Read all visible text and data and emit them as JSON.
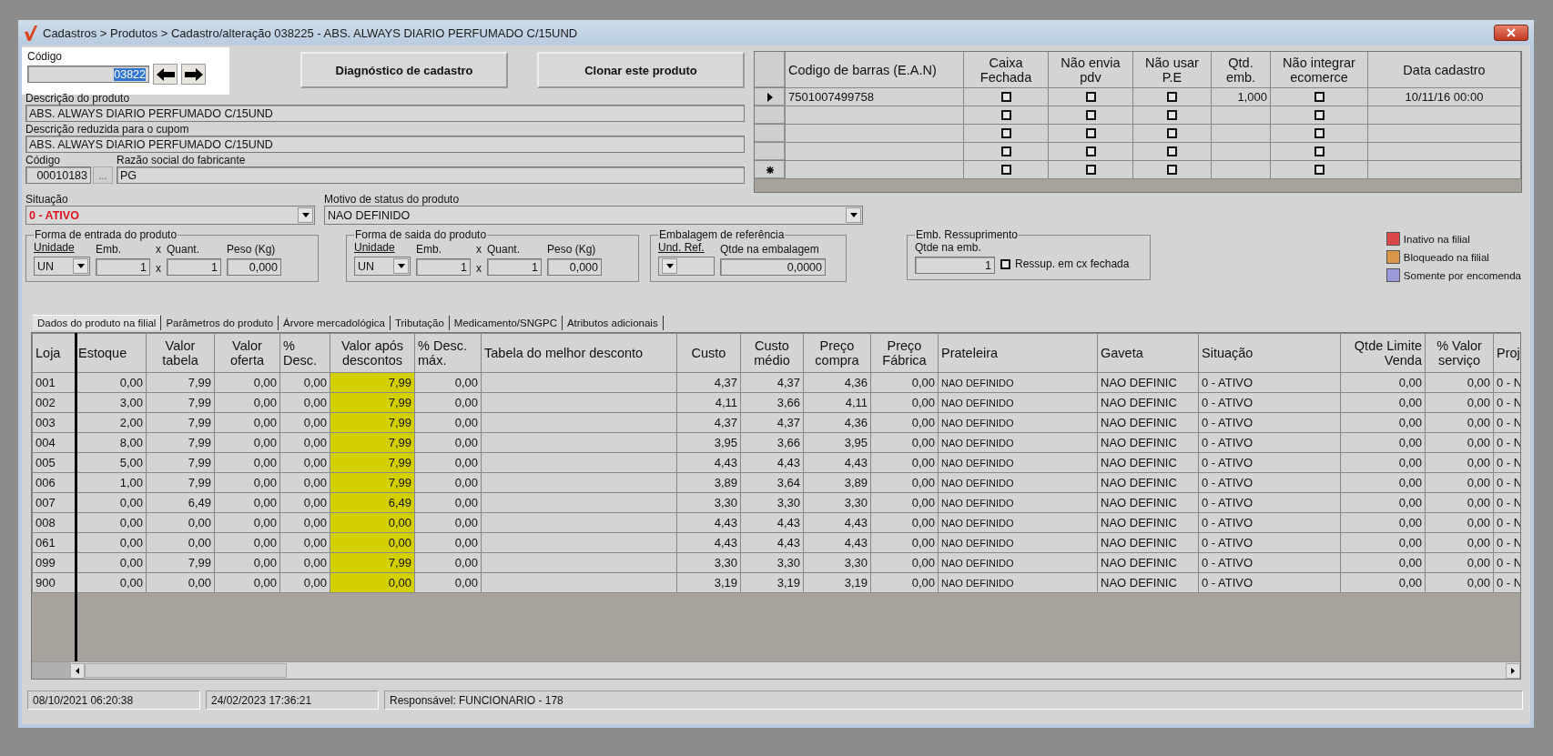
{
  "window": {
    "title": "Cadastros > Produtos > Cadastro/alteração  038225 - ABS. ALWAYS DIARIO PERFUMADO C/15UND"
  },
  "codigo": {
    "label": "Código",
    "value": "03822",
    "selected": true
  },
  "actions": [
    "Diagnóstico de cadastro",
    "Clonar este produto"
  ],
  "descricao": {
    "label": "Descrição  do produto",
    "value": "ABS. ALWAYS DIARIO PERFUMADO C/15UND"
  },
  "descricao_reduzida": {
    "label": "Descrição reduzida para o cupom",
    "value": "ABS. ALWAYS DIARIO PERFUMADO C/15UND"
  },
  "fabricante": {
    "code_label": "Código",
    "code": "00010183",
    "browse": "...",
    "name_label": "Razão social do fabricante",
    "name": "PG"
  },
  "situacao": {
    "label": "Situação",
    "value": "0 - ATIVO"
  },
  "motivo": {
    "label": "Motivo de status do produto",
    "value": "NAO DEFINIDO"
  },
  "forma_entrada": {
    "title": "Forma de entrada do produto",
    "unidade_label": "Unidade",
    "unidade": "UN",
    "emb_label": "Emb.",
    "emb": "1",
    "quant_label": "Quant.",
    "quant": "1",
    "peso_label": "Peso (Kg)",
    "peso": "0,000",
    "multiplier": [
      "x",
      "x"
    ]
  },
  "forma_saida": {
    "title": "Forma de saida do produto",
    "unidade_label": "Unidade",
    "unidade": "UN",
    "emb_label": "Emb.",
    "emb": "1",
    "quant_label": "Quant.",
    "quant": "1",
    "peso_label": "Peso (Kg)",
    "peso": "0,000",
    "multiplier": [
      "x",
      "x"
    ]
  },
  "embalagem_referencia": {
    "title": "Embalagem de referência",
    "und_label": "Und. Ref.",
    "qtde_label": "Qtde na embalagem",
    "qtde": "0,0000"
  },
  "ressuprimento": {
    "title": "Emb. Ressuprimento",
    "qtde_label": "Qtde na emb.",
    "qtde": "1",
    "check_label": "Ressup. em cx fechada",
    "checked": false
  },
  "legend": [
    {
      "label": "Inativo na filial",
      "color": "#d9474b"
    },
    {
      "label": "Bloqueado na filial",
      "color": "#d99548"
    },
    {
      "label": "Somente por encomenda",
      "color": "#9a9ad8"
    }
  ],
  "barcodes": {
    "columns": [
      "Codigo de barras (E.A.N)",
      "Caixa Fechada",
      "Não envia pdv",
      "Não usar P.E",
      "Qtd. emb.",
      "Não integrar ecomerce",
      "Data cadastro"
    ],
    "rows": [
      {
        "kind": "current",
        "ean": "7501007499758",
        "caixa_fechada": false,
        "nao_envia_pdv": false,
        "nao_usar_pe": false,
        "qtd_emb": "1,000",
        "nao_integrar": false,
        "data": "10/11/16 00:00"
      },
      {
        "kind": "none",
        "caixa_fechada": false,
        "nao_envia_pdv": false,
        "nao_usar_pe": false,
        "nao_integrar": false
      },
      {
        "kind": "none",
        "caixa_fechada": false,
        "nao_envia_pdv": false,
        "nao_usar_pe": false,
        "nao_integrar": false
      },
      {
        "kind": "none",
        "caixa_fechada": false,
        "nao_envia_pdv": false,
        "nao_usar_pe": false,
        "nao_integrar": false
      },
      {
        "kind": "new",
        "caixa_fechada": false,
        "nao_envia_pdv": false,
        "nao_usar_pe": false,
        "nao_integrar": false
      }
    ]
  },
  "tabs": [
    {
      "label": "Dados do produto na filial",
      "selected": true
    },
    {
      "label": "Parâmetros do produto",
      "selected": false
    },
    {
      "label": "Árvore mercadológica",
      "selected": false
    },
    {
      "label": "Tributação",
      "selected": false
    },
    {
      "label": "Medicamento/SNGPC",
      "selected": false
    },
    {
      "label": "Atributos adicionais",
      "selected": false
    }
  ],
  "table": {
    "columns": [
      {
        "label": "Loja",
        "highlighted": false
      },
      {
        "label": "Estoque",
        "highlighted": false
      },
      {
        "label": "Valor tabela",
        "highlighted": false
      },
      {
        "label": "Valor oferta",
        "highlighted": false
      },
      {
        "label": "% Desc.",
        "highlighted": false
      },
      {
        "label": "Valor após descontos",
        "highlighted": true
      },
      {
        "label": "% Desc. máx.",
        "highlighted": false
      },
      {
        "label": "Tabela do melhor desconto",
        "highlighted": false
      },
      {
        "label": "Custo",
        "highlighted": false
      },
      {
        "label": "Custo médio",
        "highlighted": false
      },
      {
        "label": "Preço compra",
        "highlighted": false
      },
      {
        "label": "Preço Fábrica",
        "highlighted": false
      },
      {
        "label": "Prateleira",
        "highlighted": false
      },
      {
        "label": "Gaveta",
        "highlighted": false
      },
      {
        "label": "Situação",
        "highlighted": false
      },
      {
        "label": "Qtde Limite Venda",
        "highlighted": false
      },
      {
        "label": "% Valor serviço",
        "highlighted": false
      },
      {
        "label": "Proj",
        "highlighted": false
      }
    ],
    "rows": [
      [
        "001",
        "0,00",
        "7,99",
        "0,00",
        "0,00",
        "7,99",
        "0,00",
        "",
        "4,37",
        "4,37",
        "4,36",
        "0,00",
        "NAO DEFINIDO",
        "NAO DEFINIC",
        "0 - ATIVO",
        "0,00",
        "0,00",
        "0 - N"
      ],
      [
        "002",
        "3,00",
        "7,99",
        "0,00",
        "0,00",
        "7,99",
        "0,00",
        "",
        "4,11",
        "3,66",
        "4,11",
        "0,00",
        "NAO DEFINIDO",
        "NAO DEFINIC",
        "0 - ATIVO",
        "0,00",
        "0,00",
        "0 - N"
      ],
      [
        "003",
        "2,00",
        "7,99",
        "0,00",
        "0,00",
        "7,99",
        "0,00",
        "",
        "4,37",
        "4,37",
        "4,36",
        "0,00",
        "NAO DEFINIDO",
        "NAO DEFINIC",
        "0 - ATIVO",
        "0,00",
        "0,00",
        "0 - N"
      ],
      [
        "004",
        "8,00",
        "7,99",
        "0,00",
        "0,00",
        "7,99",
        "0,00",
        "",
        "3,95",
        "3,66",
        "3,95",
        "0,00",
        "NAO DEFINIDO",
        "NAO DEFINIC",
        "0 - ATIVO",
        "0,00",
        "0,00",
        "0 - N"
      ],
      [
        "005",
        "5,00",
        "7,99",
        "0,00",
        "0,00",
        "7,99",
        "0,00",
        "",
        "4,43",
        "4,43",
        "4,43",
        "0,00",
        "NAO DEFINIDO",
        "NAO DEFINIC",
        "0 - ATIVO",
        "0,00",
        "0,00",
        "0 - N"
      ],
      [
        "006",
        "1,00",
        "7,99",
        "0,00",
        "0,00",
        "7,99",
        "0,00",
        "",
        "3,89",
        "3,64",
        "3,89",
        "0,00",
        "NAO DEFINIDO",
        "NAO DEFINIC",
        "0 - ATIVO",
        "0,00",
        "0,00",
        "0 - N"
      ],
      [
        "007",
        "0,00",
        "6,49",
        "0,00",
        "0,00",
        "6,49",
        "0,00",
        "",
        "3,30",
        "3,30",
        "3,30",
        "0,00",
        "NAO DEFINIDO",
        "NAO DEFINIC",
        "0 - ATIVO",
        "0,00",
        "0,00",
        "0 - N"
      ],
      [
        "008",
        "0,00",
        "0,00",
        "0,00",
        "0,00",
        "0,00",
        "0,00",
        "",
        "4,43",
        "4,43",
        "4,43",
        "0,00",
        "NAO DEFINIDO",
        "NAO DEFINIC",
        "0 - ATIVO",
        "0,00",
        "0,00",
        "0 - N"
      ],
      [
        "061",
        "0,00",
        "0,00",
        "0,00",
        "0,00",
        "0,00",
        "0,00",
        "",
        "4,43",
        "4,43",
        "4,43",
        "0,00",
        "NAO DEFINIDO",
        "NAO DEFINIC",
        "0 - ATIVO",
        "0,00",
        "0,00",
        "0 - N"
      ],
      [
        "099",
        "0,00",
        "7,99",
        "0,00",
        "0,00",
        "7,99",
        "0,00",
        "",
        "3,30",
        "3,30",
        "3,30",
        "0,00",
        "NAO DEFINIDO",
        "NAO DEFINIC",
        "0 - ATIVO",
        "0,00",
        "0,00",
        "0 - N"
      ],
      [
        "900",
        "0,00",
        "0,00",
        "0,00",
        "0,00",
        "0,00",
        "0,00",
        "",
        "3,19",
        "3,19",
        "3,19",
        "0,00",
        "NAO DEFINIDO",
        "NAO DEFINIC",
        "0 - ATIVO",
        "0,00",
        "0,00",
        "0 - N"
      ]
    ]
  },
  "status_bar": [
    "08/10/2021 06:20:38",
    "24/02/2023 17:36:21",
    "Responsável: FUNCIONARIO - 178"
  ]
}
